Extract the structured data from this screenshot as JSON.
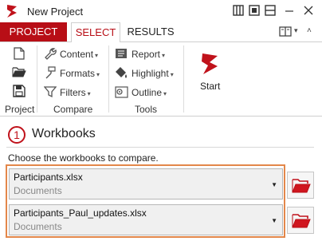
{
  "window": {
    "title": "New Project"
  },
  "tabs": [
    {
      "label": "PROJECT"
    },
    {
      "label": "SELECT"
    },
    {
      "label": "RESULTS"
    }
  ],
  "ribbon": {
    "project_group": {
      "label": "Project"
    },
    "compare_group": {
      "label": "Compare",
      "items": [
        {
          "label": "Content",
          "icon": "wrench-icon"
        },
        {
          "label": "Formats",
          "icon": "brush-icon"
        },
        {
          "label": "Filters",
          "icon": "filter-icon"
        }
      ]
    },
    "tools_group": {
      "label": "Tools",
      "items": [
        {
          "label": "Report",
          "icon": "report-icon"
        },
        {
          "label": "Highlight",
          "icon": "paint-bucket-icon"
        },
        {
          "label": "Outline",
          "icon": "outline-icon"
        }
      ]
    },
    "start": {
      "label": "Start"
    }
  },
  "workbooks": {
    "step": "1",
    "title": "Workbooks",
    "instruction": "Choose the workbooks to compare.",
    "items": [
      {
        "name": "Participants.xlsx",
        "folder": "Documents"
      },
      {
        "name": "Participants_Paul_updates.xlsx",
        "folder": "Documents"
      }
    ]
  },
  "colors": {
    "brand_red": "#b80e16",
    "highlight_orange": "#e3874a"
  }
}
